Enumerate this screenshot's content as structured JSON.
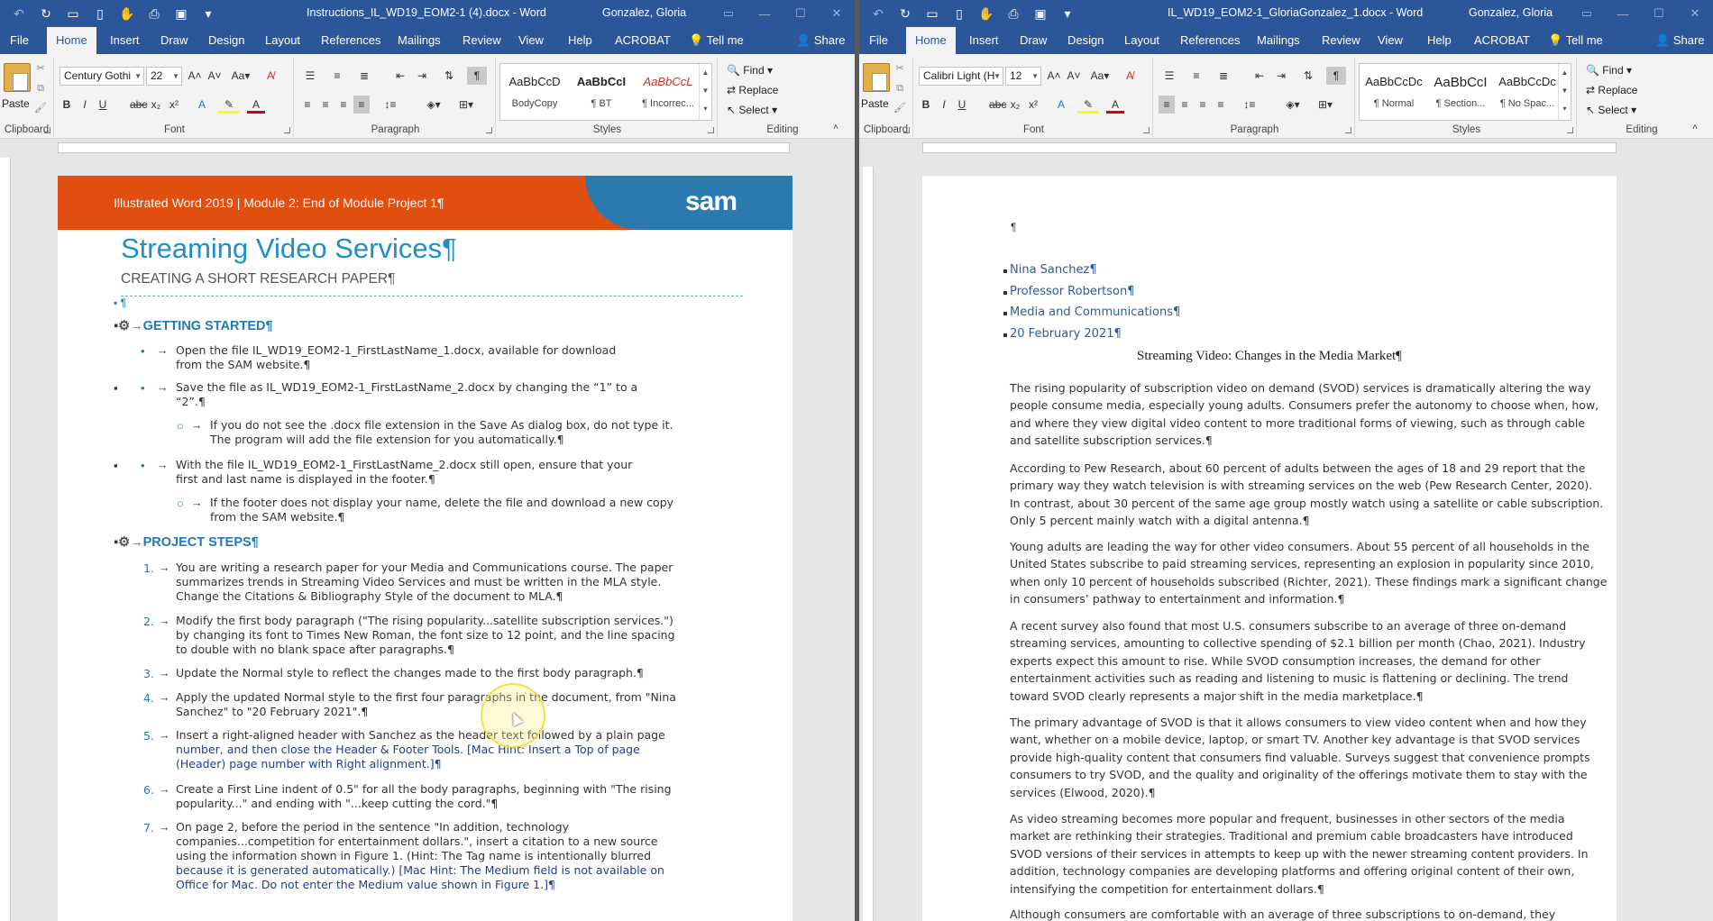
{
  "left": {
    "title": "Instructions_IL_WD19_EOM2-1 (4).docx  -  Word",
    "user": "Gonzalez, Gloria",
    "tabs": [
      "File",
      "Home",
      "Insert",
      "Draw",
      "Design",
      "Layout",
      "References",
      "Mailings",
      "Review",
      "View",
      "Help",
      "ACROBAT",
      "Tell me",
      "Share"
    ],
    "font_name": "Century Gothi",
    "font_size": "22",
    "styles": [
      {
        "preview": "AaBbCcD",
        "name": "BodyCopy"
      },
      {
        "preview": "AaBbCcI",
        "name": "¶ BT"
      },
      {
        "preview": "AaBbCcL",
        "name": "¶ Incorrec..."
      }
    ],
    "groups": {
      "clipboard": "Clipboard",
      "font": "Font",
      "paragraph": "Paragraph",
      "styles": "Styles",
      "editing": "Editing"
    },
    "paste": "Paste",
    "editing": {
      "find": "Find",
      "replace": "Replace",
      "select": "Select"
    },
    "doc": {
      "banner": "Illustrated Word 2019 | Module 2: End of Module Project 1¶",
      "logo": "sam",
      "h1": "Streaming Video Services¶",
      "h2": "CREATING A SHORT RESEARCH PAPER¶",
      "pilcrow": "¶",
      "getting_started": "GETTING STARTED¶",
      "project_steps": "PROJECT STEPS¶",
      "gs_items": [
        [
          "Open the file IL_WD19_EOM2-1_FirstLastName_1.docx, available for download",
          "from the SAM website.¶"
        ],
        [
          "Save the file as IL_WD19_EOM2-1_FirstLastName_2.docx by changing the “1” to a",
          "“2”.¶"
        ],
        [
          "If you do not see the .docx file extension in the Save As dialog box, do not type it.",
          "The program will add the file extension for you automatically.¶"
        ],
        [
          "With the file IL_WD19_EOM2-1_FirstLastName_2.docx still open, ensure that your",
          "first and last name is displayed in the footer.¶"
        ],
        [
          "If the footer does not display your name, delete the file and download a new copy",
          "from the SAM website.¶"
        ]
      ],
      "steps": [
        {
          "n": "1.",
          "lines": [
            "You are writing a research paper for your Media and Communications course. The paper",
            "summarizes trends in Streaming Video Services and must be written in the MLA style.",
            "Change the Citations & Bibliography Style of the document to MLA.¶"
          ]
        },
        {
          "n": "2.",
          "lines": [
            "Modify the first body paragraph (\"The rising popularity...satellite subscription services.\")",
            "by changing its font to Times New Roman, the font size to 12 point, and the line spacing",
            "to double with no blank space after paragraphs.¶"
          ]
        },
        {
          "n": "3.",
          "lines": [
            "Update the Normal style to reflect the changes made to the first body paragraph.¶"
          ]
        },
        {
          "n": "4.",
          "lines": [
            "Apply the updated Normal style to the first four paragraphs in the document, from \"Nina",
            "Sanchez\" to \"20 February 2021\".¶"
          ]
        },
        {
          "n": "5.",
          "lines": [
            "Insert a right-aligned header with Sanchez as the header text followed by a plain page",
            "number, and then close the Header & Footer Tools. [Mac Hint: Insert a Top of page",
            "(Header) page number with Right alignment.]¶"
          ]
        },
        {
          "n": "6.",
          "lines": [
            "Create a First Line indent of 0.5\" for all the body paragraphs, beginning with \"The rising",
            "popularity...\" and ending with \"...keep cutting the cord.\"¶"
          ]
        },
        {
          "n": "7.",
          "lines": [
            "On page 2, before the period in the sentence \"In addition, technology",
            "companies...competition for entertainment dollars.\", insert a citation to a new source",
            "using the information shown in Figure 1. (Hint: The Tag name is intentionally blurred",
            "because it is generated automatically.) [Mac Hint: The Medium field is not available on",
            "Office for Mac. Do not enter the Medium value shown in Figure 1.]¶"
          ]
        }
      ]
    }
  },
  "right": {
    "title": "IL_WD19_EOM2-1_GloriaGonzalez_1.docx  -  Word",
    "user": "Gonzalez, Gloria",
    "tabs": [
      "File",
      "Home",
      "Insert",
      "Draw",
      "Design",
      "Layout",
      "References",
      "Mailings",
      "Review",
      "View",
      "Help",
      "ACROBAT",
      "Tell me",
      "Share"
    ],
    "font_name": "Calibri Light (H",
    "font_size": "12",
    "styles": [
      {
        "preview": "AaBbCcDc",
        "name": "¶ Normal"
      },
      {
        "preview": "AaBbCcI",
        "name": "¶ Section..."
      },
      {
        "preview": "AaBbCcDc",
        "name": "¶ No Spac..."
      }
    ],
    "groups": {
      "clipboard": "Clipboard",
      "font": "Font",
      "paragraph": "Paragraph",
      "styles": "Styles",
      "editing": "Editing"
    },
    "paste": "Paste",
    "editing": {
      "find": "Find",
      "replace": "Replace",
      "select": "Select"
    },
    "doc": {
      "pilcrow": "¶",
      "header_lines": [
        "Nina Sanchez¶",
        "Professor Robertson¶",
        "Media and Communications¶",
        "20 February 2021¶"
      ],
      "title": "Streaming Video: Changes in the Media Market¶",
      "paragraphs": [
        [
          "The rising popularity of subscription video on demand (SVOD) services is dramatically altering the way",
          "people consume media, especially young adults. Consumers prefer the autonomy to choose when, how,",
          "and where they view digital video content to more traditional forms of viewing, such as through cable",
          "and satellite subscription services.¶"
        ],
        [
          "According to Pew Research, about 60 percent of adults between the ages of 18 and 29 report that the",
          "primary way they watch television is with streaming services on the web (Pew Research Center, 2020).",
          "In contrast, about 30 percent of the same age group mostly watch using a satellite or cable subscription.",
          "Only 5 percent mainly watch with a digital antenna.¶"
        ],
        [
          "Young adults are leading the way for other video consumers. About 55 percent of all households in the",
          "United States subscribe to paid streaming services, representing an explosion in popularity since 2010,",
          "when only 10 percent of households subscribed (Richter, 2021). These findings mark a significant change",
          "in consumers’ pathway to entertainment and information.¶"
        ],
        [
          "A recent survey also found that most U.S. consumers subscribe to an average of three on-demand",
          "streaming services, amounting to collective spending of $2.1 billion per month (Chao, 2021). Industry",
          "experts expect this amount to rise. While SVOD consumption increases, the demand for other",
          "entertainment activities such as reading and listening to music is flattening or declining. The trend",
          "toward SVOD clearly represents a major shift in the media marketplace.¶"
        ],
        [
          "The primary advantage of SVOD is that it allows consumers to view video content when and how they",
          "want, whether on a mobile device, laptop, or smart TV. Another key advantage is that SVOD services",
          "provide high-quality content that consumers find valuable. Surveys suggest that convenience prompts",
          "consumers to try SVOD, and the quality and originality of the offerings motivate them to stay with the",
          "services (Elwood, 2020).¶"
        ],
        [
          "As video streaming becomes more popular and frequent, businesses in other sectors of the media",
          "market are rethinking their strategies. Traditional and premium cable broadcasters have introduced",
          "SVOD versions of their services in attempts to keep up with the newer streaming content providers. In",
          "addition, technology companies are developing platforms and offering original content of their own,",
          "intensifying the competition for entertainment dollars.¶"
        ],
        [
          "Although consumers are comfortable with an average of three subscriptions to on-demand, they"
        ]
      ]
    }
  }
}
